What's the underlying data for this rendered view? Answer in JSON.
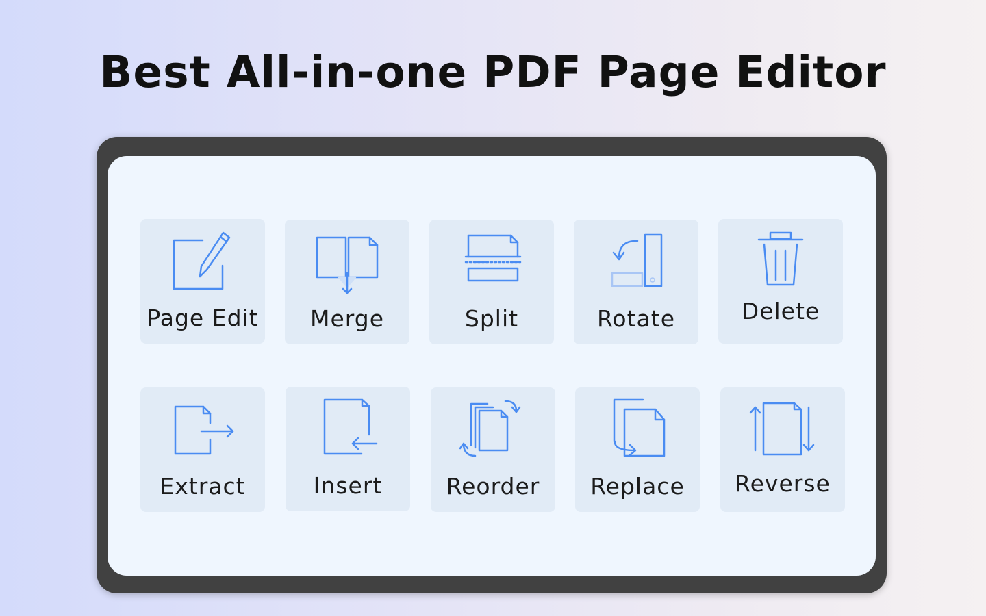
{
  "headline": "Best All-in-one PDF Page Editor",
  "accent_color": "#4a8cf2",
  "tools": [
    {
      "label": "Page Edit",
      "icon": "page-edit-icon"
    },
    {
      "label": "Merge",
      "icon": "merge-icon"
    },
    {
      "label": "Split",
      "icon": "split-icon"
    },
    {
      "label": "Rotate",
      "icon": "rotate-icon"
    },
    {
      "label": "Delete",
      "icon": "trash-icon"
    },
    {
      "label": "Extract",
      "icon": "extract-icon"
    },
    {
      "label": "Insert",
      "icon": "insert-icon"
    },
    {
      "label": "Reorder",
      "icon": "reorder-icon"
    },
    {
      "label": "Replace",
      "icon": "replace-icon"
    },
    {
      "label": "Reverse",
      "icon": "reverse-icon"
    }
  ]
}
